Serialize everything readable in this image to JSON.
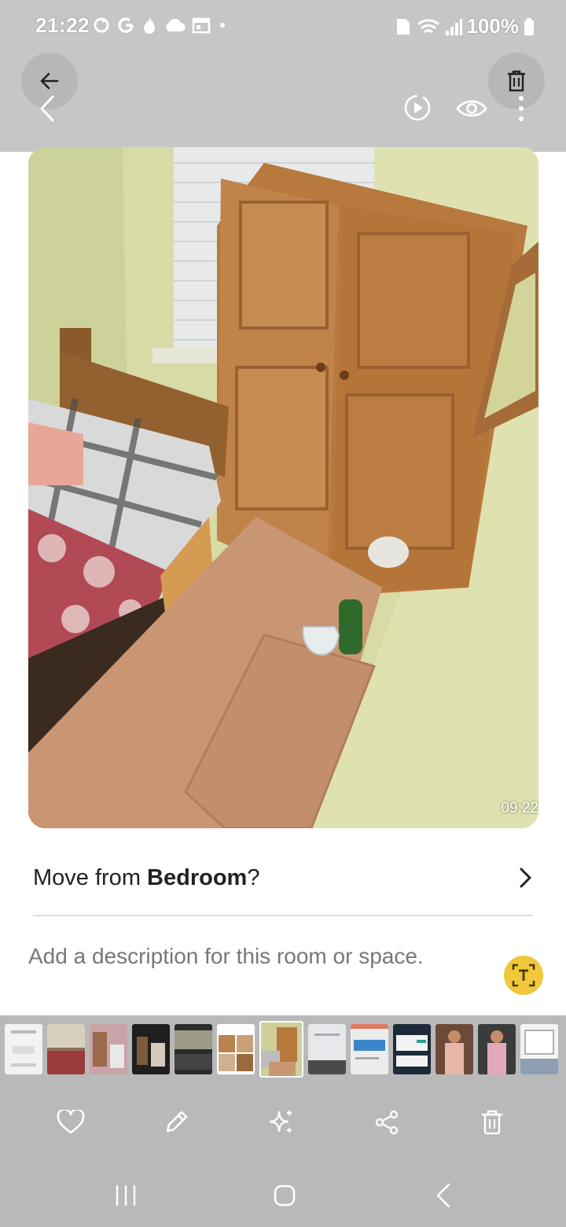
{
  "status_bar": {
    "time": "21:22",
    "battery": "100%",
    "icons_left": [
      "sync-icon",
      "google-icon",
      "fire-icon",
      "cloud-icon",
      "calendar-icon",
      "dot-icon"
    ],
    "icons_right": [
      "sim-icon",
      "wifi-icon",
      "signal-icon",
      "battery-icon"
    ]
  },
  "header": {
    "back_icon": "arrow-left-icon",
    "back_chevron_icon": "chevron-left-icon",
    "delete_icon": "trash-icon",
    "motion_icon": "motion-photo-icon",
    "view_icon": "eye-icon",
    "more_icon": "more-vertical-icon"
  },
  "photo": {
    "timestamp": "09:22"
  },
  "move_prompt": {
    "prefix": "Move from ",
    "room": "Bedroom",
    "suffix": "?"
  },
  "description": {
    "placeholder": "Add a description for this room or space."
  },
  "thumbnails": {
    "count": 14,
    "selected_index": 6
  },
  "actions": [
    "heart-icon",
    "pencil-icon",
    "sparkle-icon",
    "share-icon",
    "trash-icon"
  ],
  "nav": [
    "recents-icon",
    "home-icon",
    "back-icon"
  ],
  "colors": {
    "overlay": "#c6c6c6",
    "panel": "#b9b9b9",
    "ocr": "#f1c83b"
  }
}
